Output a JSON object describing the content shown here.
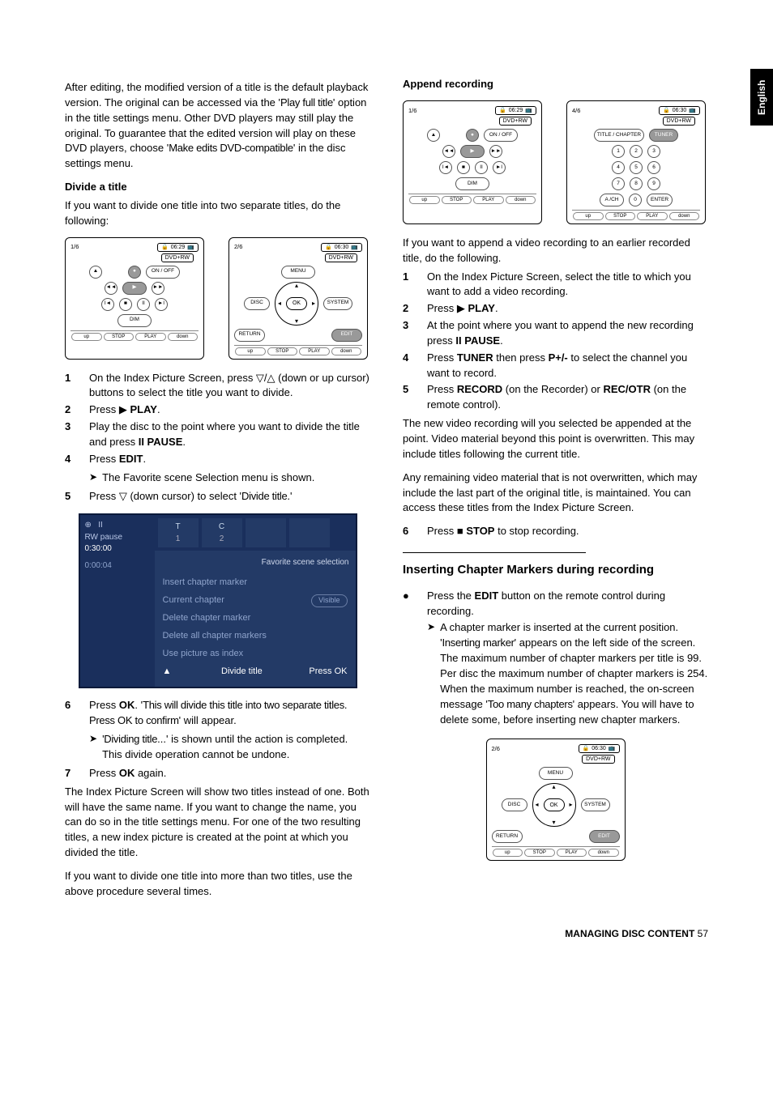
{
  "tab": "English",
  "footer": {
    "label": "MANAGING DISC CONTENT",
    "page": "57"
  },
  "left": {
    "intro": "After editing, the modified version of a title is the default playback version. The original can be accessed via the '",
    "intro_osd": "Play full title",
    "intro2": "' option in the title settings menu. Other DVD players may still play the original. To guarantee that the edited version will play on these DVD players, choose '",
    "intro_osd2": "Make edits DVD-compatible",
    "intro3": "' in the disc settings menu.",
    "h_divide": "Divide a title",
    "divide_intro": "If you want to divide one title into two separate titles, do the following:",
    "steps1": [
      {
        "n": "1",
        "t": "On the Index Picture Screen, press ▽/△ (down or up cursor) buttons to select the title you want to divide."
      },
      {
        "n": "2",
        "pre": "Press ▶ ",
        "b": "PLAY",
        "post": "."
      },
      {
        "n": "3",
        "t": "Play the disc to the point where you want to divide the title and press ",
        "b": "II PAUSE",
        "post": "."
      },
      {
        "n": "4",
        "pre": "Press ",
        "b": "EDIT",
        "post": "."
      }
    ],
    "sub1": "The Favorite scene Selection menu is shown.",
    "step5": {
      "n": "5",
      "pre": "Press ▽  (down cursor) to select '",
      "osd": "Divide title",
      "post": ".'"
    },
    "steps2": [
      {
        "n": "6",
        "pre": "Press ",
        "b": "OK",
        "mid": ". '",
        "osd": "This will divide this title into two separate titles.  Press OK to confirm",
        "post": "' will appear."
      }
    ],
    "sub2": {
      "osd": "'Dividing title",
      "rest": "...' is shown until the action is completed. This divide operation cannot be undone."
    },
    "step7": {
      "n": "7",
      "pre": "Press ",
      "b": "OK",
      "post": " again."
    },
    "para1": "The Index Picture Screen will show two titles instead of one. Both will have the same name. If you want to change the name, you can do so in the title settings menu. For one of the two resulting titles, a new index picture is created at the point at which you divided the title.",
    "para2": "If you want to divide one title into more than two titles, use the above procedure several times.",
    "shot": {
      "top_letters": [
        "T",
        "C"
      ],
      "top_nums": [
        "1",
        "2"
      ],
      "title": "Favorite scene selection",
      "left_lines": [
        "II",
        "RW  pause",
        "0:30:00",
        "0:00:04"
      ],
      "items": [
        {
          "l": "Insert chapter marker"
        },
        {
          "l": "Current chapter",
          "r": "Visible"
        },
        {
          "l": "Delete chapter marker"
        },
        {
          "l": "Delete all chapter markers"
        },
        {
          "l": "Use picture as index"
        },
        {
          "l": "Divide title",
          "r": "Press OK",
          "sel": true
        }
      ]
    }
  },
  "right": {
    "h_append": "Append recording",
    "append_intro": "If you want to append a video recording to an earlier recorded title, do the following.",
    "steps": [
      {
        "n": "1",
        "t": "On the Index Picture Screen, select the title to which you want to add a video recording."
      },
      {
        "n": "2",
        "pre": "Press ▶ ",
        "b": "PLAY",
        "post": "."
      },
      {
        "n": "3",
        "t": "At the point where you want to append the new recording press ",
        "b": "II PAUSE",
        "post": "."
      },
      {
        "n": "4",
        "pre": "Press ",
        "b": "TUNER",
        "mid": " then press ",
        "b2": "P+/-",
        "post": " to select the channel you want to record."
      },
      {
        "n": "5",
        "pre": "Press ",
        "b": "RECORD",
        "mid": " (on the Recorder) or ",
        "b2": "REC/OTR",
        "post": " (on the remote control)."
      }
    ],
    "para1": "The new video recording will you selected be appended at the point. Video material beyond this point is overwritten. This may include titles following the current title.",
    "para2": "Any remaining video material that is not overwritten, which may include the last part of the original title, is maintained. You can access these titles from the Index Picture Screen.",
    "step6": {
      "n": "6",
      "pre": "Press ■ ",
      "b": "STOP",
      "post": " to stop recording."
    },
    "h_insert": "Inserting Chapter Markers during recording",
    "bullet_pre": "Press the ",
    "bullet_b": "EDIT",
    "bullet_post": " button on the remote control during recording.",
    "sub_pre": "A chapter marker is inserted at the current position. '",
    "sub_osd": "Inserting marker",
    "sub_mid": "' appears on the left side of the screen. The maximum number of chapter markers per title is 99. Per disc the maximum number of chapter markers is 254. When the maximum number is reached, the on-screen message '",
    "sub_osd2": "Too many chapters",
    "sub_end": "' appears. You will have to delete some, before inserting new chapter markers."
  },
  "remote": {
    "lcd": "DVD+RW",
    "onoff": "ON / OFF",
    "menu": "MENU",
    "system": "SYSTEM",
    "disc": "DISC",
    "dim": "DIM",
    "ok": "OK",
    "return": "RETURN",
    "edit": "EDIT",
    "titlech": "TITLE / CHAPTER",
    "tuner": "TUNER",
    "ach": "A /CH",
    "enter": "ENTER",
    "bottom": [
      "up",
      "STOP",
      "PLAY",
      "down"
    ],
    "c14": "1/6",
    "c26": "2/6",
    "c46": "4/6",
    "time1": "06:29",
    "time2": "06:30"
  }
}
